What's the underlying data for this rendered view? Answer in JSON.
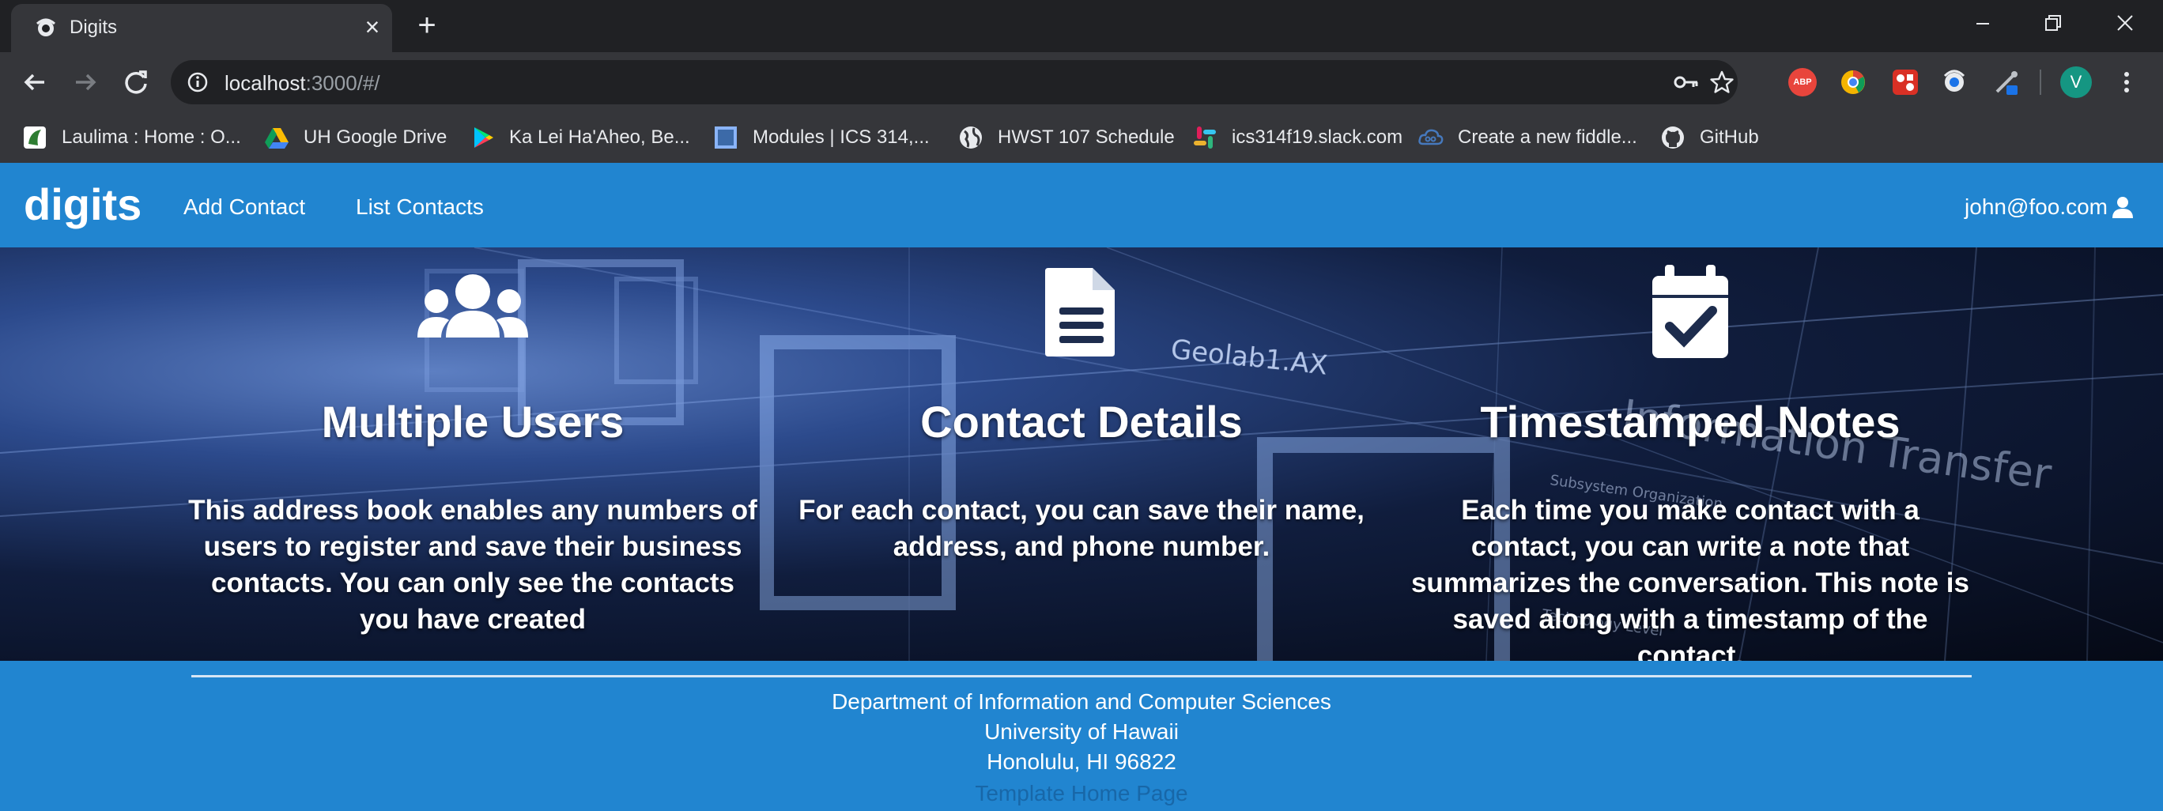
{
  "browser": {
    "tab_title": "Digits",
    "url_host": "localhost",
    "url_rest": ":3000/#/",
    "profile_initial": "V",
    "bookmarks": [
      {
        "label": "Laulima : Home : O...",
        "icon": "laulima-icon"
      },
      {
        "label": "UH Google Drive",
        "icon": "google-drive-icon"
      },
      {
        "label": "Ka Lei Ha'Aheo, Be...",
        "icon": "google-play-icon"
      },
      {
        "label": "Modules | ICS 314,...",
        "icon": "modules-icon"
      },
      {
        "label": "HWST 107 Schedule",
        "icon": "globe-icon"
      },
      {
        "label": "ics314f19.slack.com",
        "icon": "slack-icon"
      },
      {
        "label": "Create a new fiddle...",
        "icon": "jsfiddle-icon"
      },
      {
        "label": "GitHub",
        "icon": "github-icon"
      }
    ],
    "extensions": [
      "adblock-plus-icon",
      "chrome-extension-icon",
      "puzzle-extension-icon",
      "theme-extension-icon",
      "eyedropper-extension-icon"
    ]
  },
  "navbar": {
    "brand": "digits",
    "links": [
      "Add Contact",
      "List Contacts"
    ],
    "user": "john@foo.com"
  },
  "features": [
    {
      "icon": "users-icon",
      "title": "Multiple Users",
      "text": "This address book enables any numbers of users to register and save their business contacts. You can only see the contacts you have created"
    },
    {
      "icon": "file-text-icon",
      "title": "Contact Details",
      "text": "For each contact, you can save their name, address, and phone number."
    },
    {
      "icon": "calendar-check-icon",
      "title": "Timestamped Notes",
      "text": "Each time you make contact with a contact, you can write a note that summarizes the conversation. This note is saved along with a timestamp of the contact."
    }
  ],
  "hero_background_text": [
    "Geolab1.AX",
    "Information Transfer",
    "Subsystem Organization",
    "Technology Level"
  ],
  "footer": {
    "line1": "Department of Information and Computer Sciences",
    "line2": "University of Hawaii",
    "line3": "Honolulu, HI 96822",
    "link": "Template Home Page"
  },
  "colors": {
    "navbar": "#2185d0",
    "chrome_dark": "#202124",
    "chrome_toolbar": "#35363a"
  }
}
